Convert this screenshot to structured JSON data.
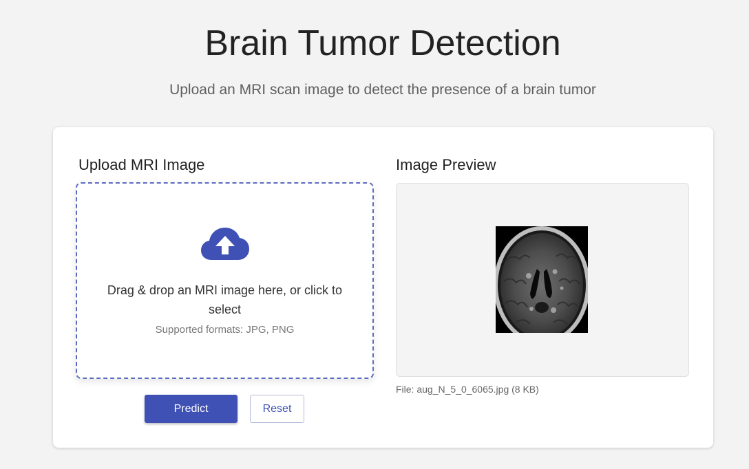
{
  "header": {
    "title": "Brain Tumor Detection",
    "subtitle": "Upload an MRI scan image to detect the presence of a brain tumor"
  },
  "upload": {
    "heading": "Upload MRI Image",
    "icon": "cloud-upload-icon",
    "drop_text": "Drag & drop an MRI image here, or click to select",
    "formats_text": "Supported formats: JPG, PNG",
    "predict_label": "Predict",
    "reset_label": "Reset"
  },
  "preview": {
    "heading": "Image Preview",
    "file_info": "File: aug_N_5_0_6065.jpg (8 KB)"
  },
  "colors": {
    "accent": "#3f51b5",
    "dropzone_border": "#5c6bc0",
    "background": "#f3f3f3"
  }
}
